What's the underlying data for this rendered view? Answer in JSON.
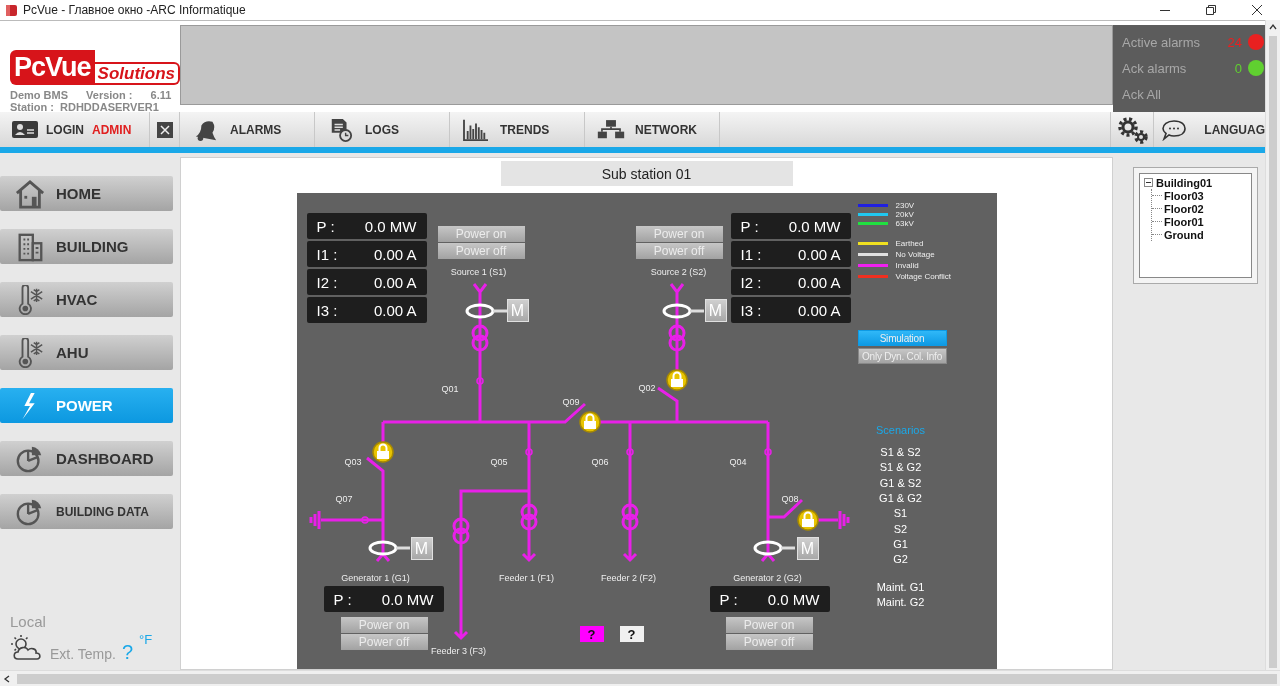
{
  "window": {
    "title": "PcVue  -  Главное окно  -ARC Informatique"
  },
  "logo": {
    "brand": "PcVue",
    "tagline": "Solutions"
  },
  "info": {
    "project": "Demo BMS",
    "version_label": "Version :",
    "version": "6.11",
    "station_label": "Station :",
    "station": "RDHDDASERVER1"
  },
  "alarms": [
    {
      "label": "Active alarms",
      "count": "24",
      "color": "#e82020"
    },
    {
      "label": "Ack alarms",
      "count": "0",
      "color": "#60d030"
    }
  ],
  "ack_all": "Ack All",
  "toolbar": {
    "login": "LOGIN",
    "user": "ADMIN",
    "items": [
      "ALARMS",
      "LOGS",
      "TRENDS",
      "NETWORK"
    ],
    "language": "LANGUAG"
  },
  "nav": [
    {
      "label": "HOME",
      "selected": false
    },
    {
      "label": "BUILDING",
      "selected": false
    },
    {
      "label": "HVAC",
      "selected": false
    },
    {
      "label": "AHU",
      "selected": false
    },
    {
      "label": "POWER",
      "selected": true
    },
    {
      "label": "DASHBOARD",
      "selected": false
    },
    {
      "label": "BUILDING DATA",
      "selected": false
    }
  ],
  "local": {
    "title": "Local",
    "temp_label": "Ext. Temp.",
    "temp_value": "?",
    "unit": "°F"
  },
  "page_title": "Sub station 01",
  "diagram": {
    "sources": [
      {
        "name": "Source 1 (S1)",
        "motor": "M",
        "power_on": "Power on",
        "power_off": "Power off",
        "readings": [
          {
            "label": "P :",
            "value": "0.0 MW"
          },
          {
            "label": "I1 :",
            "value": "0.00 A"
          },
          {
            "label": "I2 :",
            "value": "0.00 A"
          },
          {
            "label": "I3 :",
            "value": "0.00 A"
          }
        ]
      },
      {
        "name": "Source 2 (S2)",
        "motor": "M",
        "power_on": "Power on",
        "power_off": "Power off",
        "readings": [
          {
            "label": "P :",
            "value": "0.0 MW"
          },
          {
            "label": "I1 :",
            "value": "0.00 A"
          },
          {
            "label": "I2 :",
            "value": "0.00 A"
          },
          {
            "label": "I3 :",
            "value": "0.00 A"
          }
        ]
      }
    ],
    "generators": [
      {
        "name": "Generator 1 (G1)",
        "motor": "M",
        "power_on": "Power on",
        "power_off": "Power off",
        "readings": [
          {
            "label": "P :",
            "value": "0.0 MW"
          }
        ]
      },
      {
        "name": "Generator 2 (G2)",
        "motor": "M",
        "power_on": "Power on",
        "power_off": "Power off",
        "readings": [
          {
            "label": "P :",
            "value": "0.0 MW"
          }
        ]
      }
    ],
    "feeders": [
      "Feeder 1 (F1)",
      "Feeder 2 (F2)",
      "Feeder 3 (F3)"
    ],
    "breakers": [
      {
        "label": "Q01",
        "locked": false
      },
      {
        "label": "Q02",
        "locked": true
      },
      {
        "label": "Q09",
        "locked": true
      },
      {
        "label": "Q03",
        "locked": true
      },
      {
        "label": "Q05",
        "locked": false
      },
      {
        "label": "Q06",
        "locked": false
      },
      {
        "label": "Q04",
        "locked": false
      },
      {
        "label": "Q07",
        "locked": false
      },
      {
        "label": "Q08",
        "locked": true
      }
    ],
    "legend": [
      {
        "label": "230V",
        "color": "#2020e0"
      },
      {
        "label": "20kV",
        "color": "#20c8f0"
      },
      {
        "label": "63kV",
        "color": "#20e040"
      },
      {
        "label": "Earthed",
        "color": "#f0e020"
      },
      {
        "label": "No Voltage",
        "color": "#e0e0e0"
      },
      {
        "label": "Invalid",
        "color": "#f020f0"
      },
      {
        "label": "Voltage Conflict",
        "color": "#f03020"
      }
    ],
    "modes": [
      {
        "label": "Simulation",
        "on": true
      },
      {
        "label": "Only Dyn. Col. Info",
        "on": false
      }
    ],
    "scenarios_title": "Scenarios",
    "scenarios": [
      "S1 & S2",
      "S1 & G2",
      "G1 & S2",
      "G1 & G2",
      "S1",
      "S2",
      "G1",
      "G2"
    ],
    "maintenance": [
      "Maint. G1",
      "Maint. G2"
    ],
    "help_buttons": [
      {
        "label": "?",
        "color": "#ff00ff"
      },
      {
        "label": "?",
        "color": "#f0f0f0"
      }
    ]
  },
  "tree": [
    {
      "label": "Building01",
      "expanded": true,
      "children": [
        {
          "label": "Floor03"
        },
        {
          "label": "Floor02"
        },
        {
          "label": "Floor01"
        },
        {
          "label": "Ground"
        }
      ]
    }
  ]
}
